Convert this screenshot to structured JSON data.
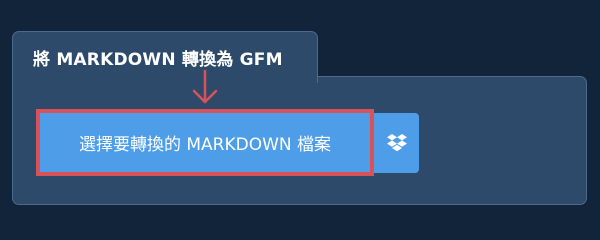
{
  "panel": {
    "title": "將 MARKDOWN 轉換為 GFM"
  },
  "select_button": {
    "label": "選擇要轉換的 MARKDOWN 檔案"
  },
  "dropbox_button": {
    "icon": "dropbox-icon"
  },
  "annotation": {
    "arrow_color": "#d9525a",
    "highlight_color": "#d9525a"
  },
  "colors": {
    "background": "#12243a",
    "panel": "#2d4a6a",
    "button": "#4d9de8"
  }
}
